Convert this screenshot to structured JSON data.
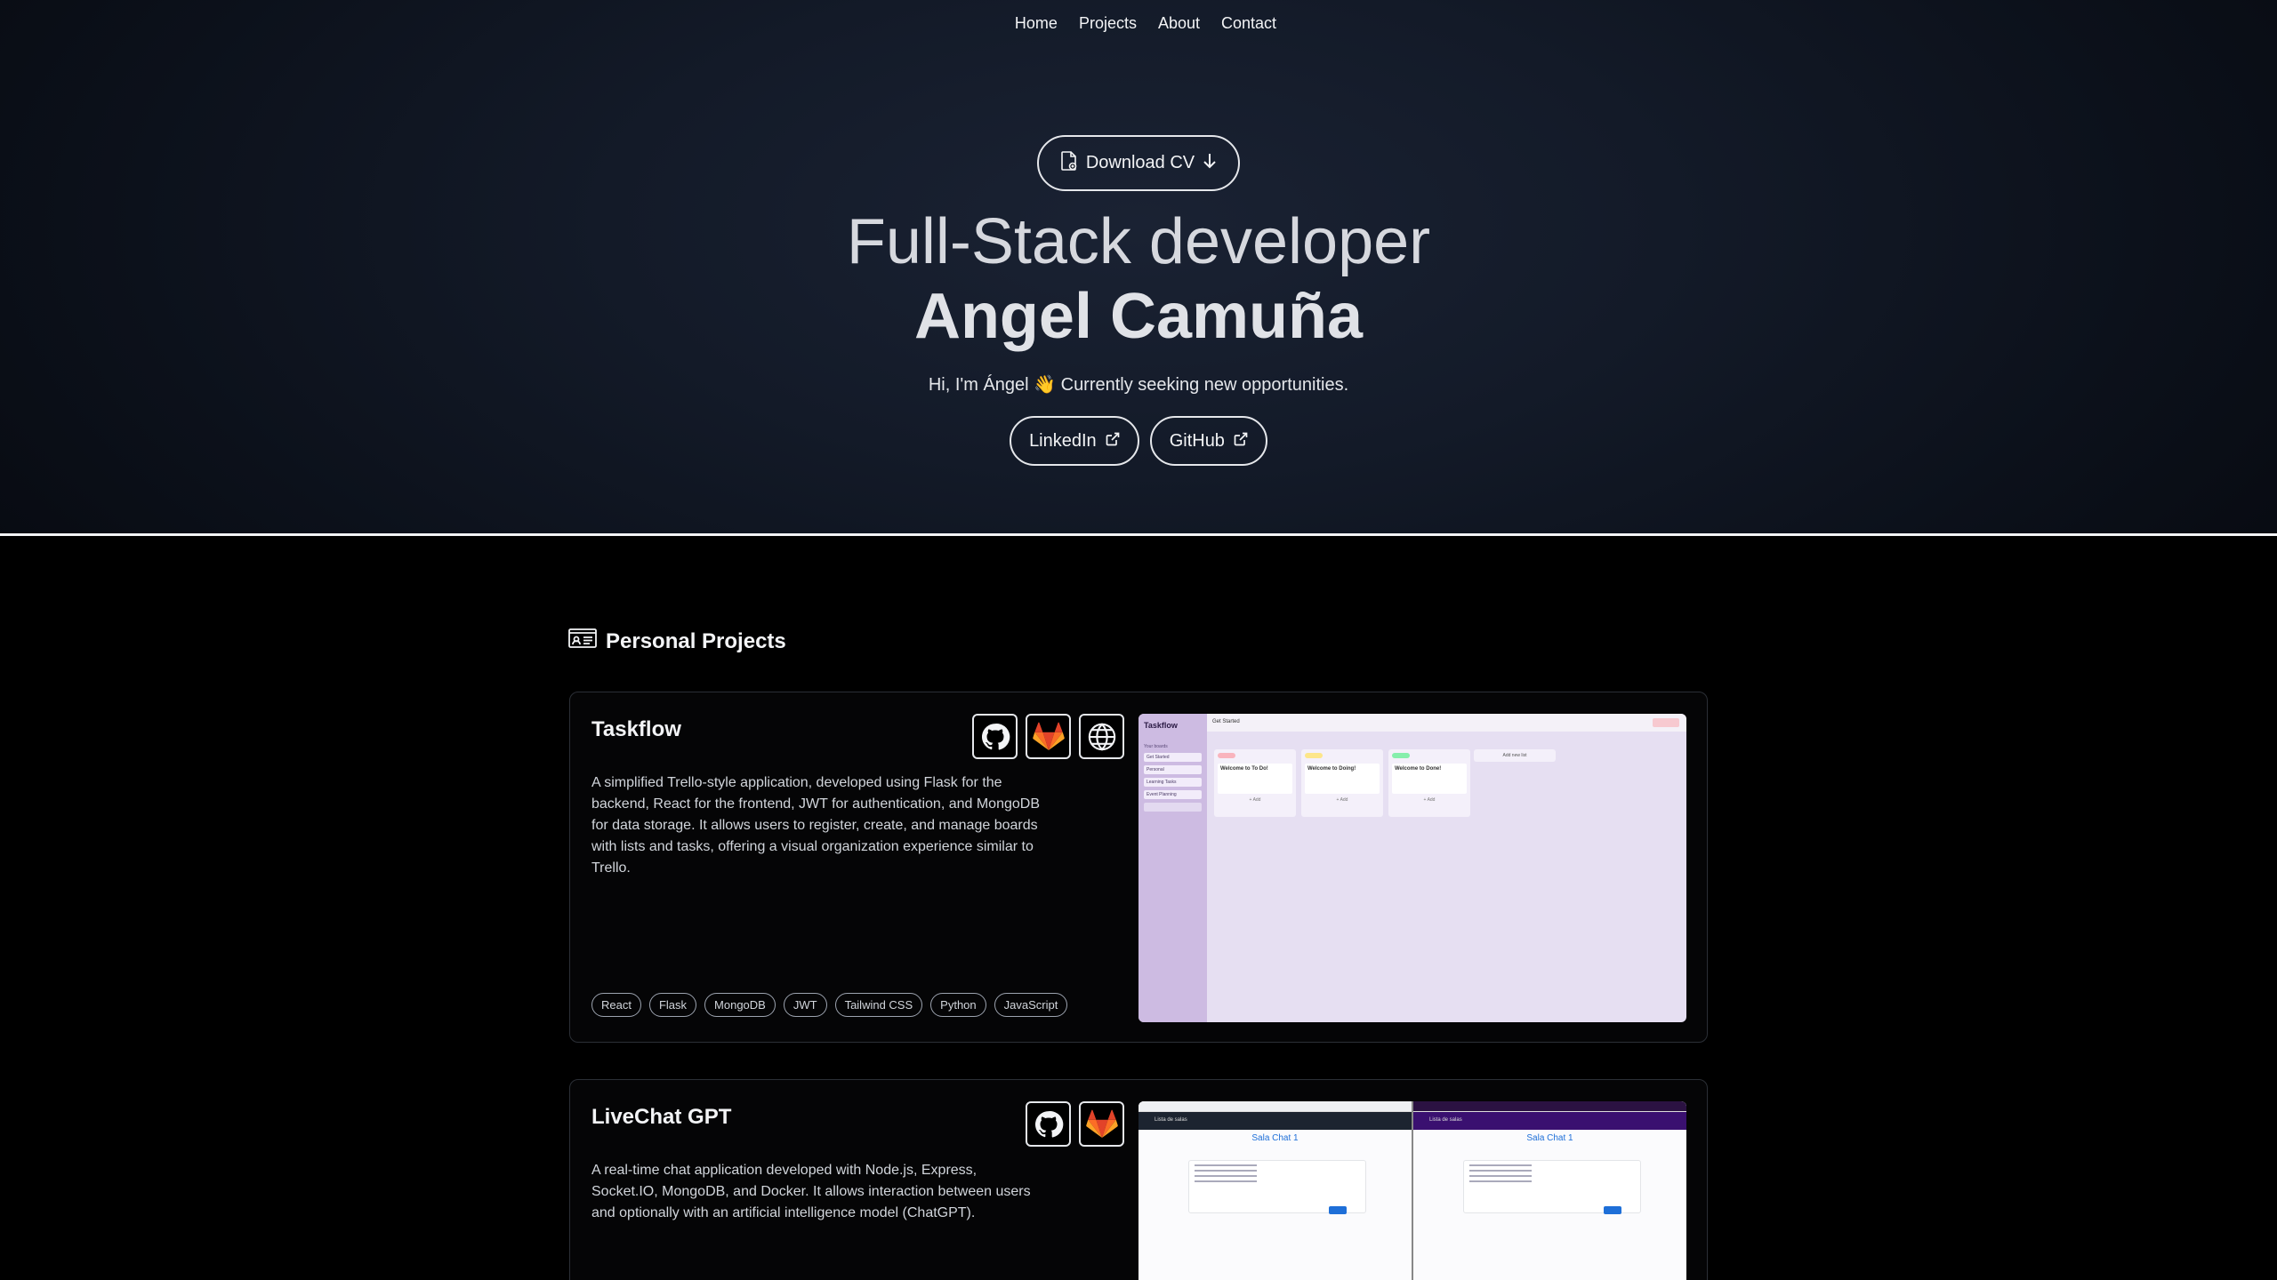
{
  "nav": {
    "items": [
      "Home",
      "Projects",
      "About",
      "Contact"
    ]
  },
  "hero": {
    "cv_button": "Download CV",
    "title": "Full-Stack developer",
    "name": "Angel Camuña",
    "subtitle": "Hi, I'm Ángel 👋 Currently seeking new opportunities.",
    "linkedin": "LinkedIn",
    "github": "GitHub"
  },
  "projects": {
    "section_title": "Personal Projects",
    "items": [
      {
        "title": "Taskflow",
        "description": "A simplified Trello-style application, developed using Flask for the backend, React for the frontend, JWT for authentication, and MongoDB for data storage. It allows users to register, create, and manage boards with lists and tasks, offering a visual organization experience similar to Trello.",
        "tags": [
          "React",
          "Flask",
          "MongoDB",
          "JWT",
          "Tailwind CSS",
          "Python",
          "JavaScript"
        ],
        "links": [
          "github-icon",
          "gitlab-icon",
          "globe-icon"
        ],
        "preview": {
          "app_name": "Taskflow",
          "sidebar_label": "Your boards",
          "boards": [
            "Get Started",
            "Personal",
            "Learning Tasks",
            "Event Planning"
          ],
          "header": "Get Started",
          "columns": [
            {
              "title": "Welcome to To Do!",
              "chip_color": "#f9b4bd"
            },
            {
              "title": "Welcome to Doing!",
              "chip_color": "#fde68a"
            },
            {
              "title": "Welcome to Done!",
              "chip_color": "#86efac"
            }
          ],
          "add_card": "+ Add",
          "add_list": "Add new list"
        }
      },
      {
        "title": "LiveChat GPT",
        "description": "A real-time chat application developed with Node.js, Express, Socket.IO, MongoDB, and Docker. It allows interaction between users and optionally with an artificial intelligence model (ChatGPT).",
        "links": [
          "github-icon",
          "gitlab-icon"
        ],
        "preview": {
          "room_title": "Sala Chat 1",
          "nav_label": "Lista de salas"
        }
      }
    ]
  },
  "colors": {
    "background": "#000000",
    "accent_border": "#e5e7eb",
    "gitlab_orange": "#e24329"
  }
}
